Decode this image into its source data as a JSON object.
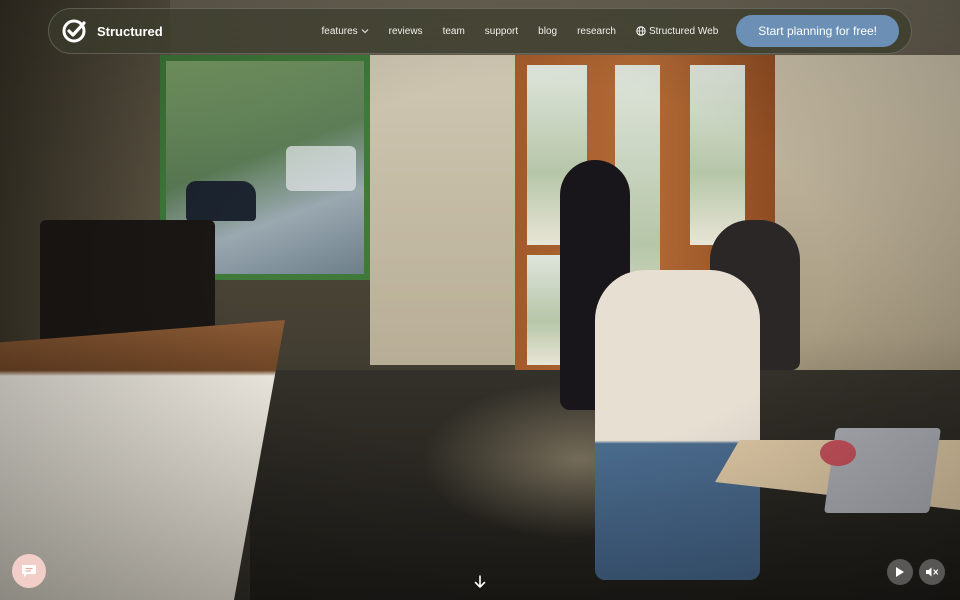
{
  "brand": {
    "name": "Structured",
    "icon": "structured-logo-icon"
  },
  "nav": {
    "links": [
      {
        "label": "features",
        "has_dropdown": true
      },
      {
        "label": "reviews"
      },
      {
        "label": "team"
      },
      {
        "label": "support"
      },
      {
        "label": "blog"
      },
      {
        "label": "research"
      },
      {
        "label": "Structured Web",
        "icon": "globe-icon"
      }
    ],
    "cta_label": "Start planning for free!"
  },
  "controls": {
    "chat_icon": "chat-icon",
    "scroll_icon": "arrow-down-icon",
    "play_icon": "play-icon",
    "mute_icon": "speaker-muted-icon"
  },
  "colors": {
    "cta": "#6b8fb5",
    "nav_bg": "#3a3c2c",
    "chat_bg": "#f1cfc8"
  }
}
